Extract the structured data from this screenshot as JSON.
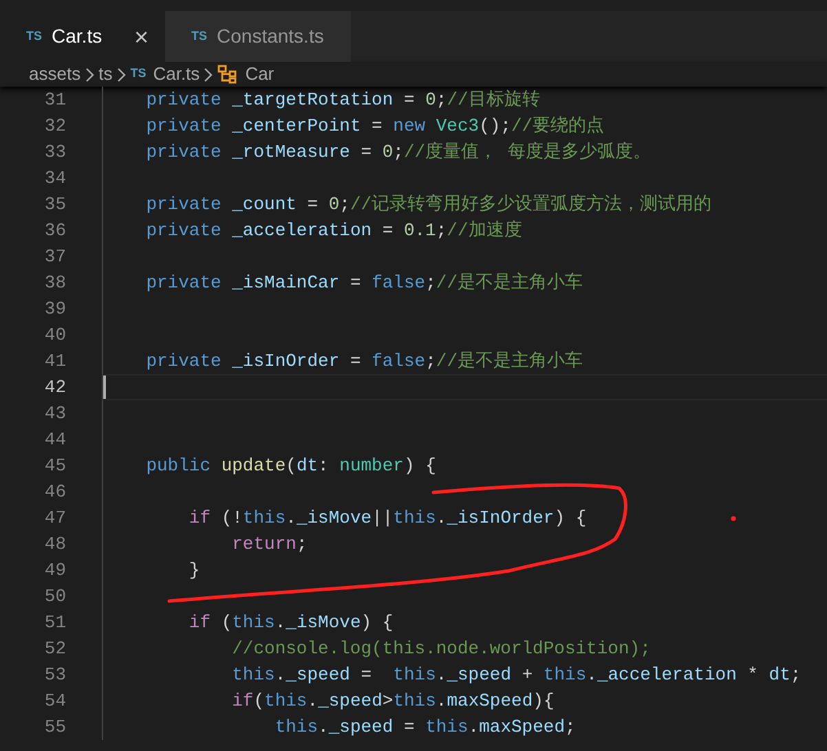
{
  "tabs": [
    {
      "label": "Car.ts",
      "badge": "TS",
      "selected": true,
      "close": "×"
    },
    {
      "label": "Constants.ts",
      "badge": "TS",
      "selected": false
    }
  ],
  "breadcrumb": [
    {
      "kind": "folder",
      "text": "assets"
    },
    {
      "kind": "folder",
      "text": "ts"
    },
    {
      "kind": "file",
      "badge": "TS",
      "text": "Car.ts"
    },
    {
      "kind": "class",
      "text": "Car"
    }
  ],
  "lines": [
    {
      "number": "31",
      "current": false,
      "tokens": [
        {
          "kind": "keyword",
          "text": "    private"
        },
        {
          "kind": "ident",
          "text": " _targetRotation"
        },
        {
          "kind": "plain",
          "text": " = "
        },
        {
          "kind": "number",
          "text": "0"
        },
        {
          "kind": "plain",
          "text": ";"
        },
        {
          "kind": "comment",
          "text": "//目标旋转"
        }
      ]
    },
    {
      "number": "32",
      "current": false,
      "tokens": [
        {
          "kind": "keyword",
          "text": "    private"
        },
        {
          "kind": "ident",
          "text": " _centerPoint"
        },
        {
          "kind": "plain",
          "text": " = "
        },
        {
          "kind": "keyword",
          "text": "new"
        },
        {
          "kind": "type",
          "text": " Vec3"
        },
        {
          "kind": "plain",
          "text": "();"
        },
        {
          "kind": "comment",
          "text": "//要绕的点"
        }
      ]
    },
    {
      "number": "33",
      "current": false,
      "tokens": [
        {
          "kind": "keyword",
          "text": "    private"
        },
        {
          "kind": "ident",
          "text": " _rotMeasure"
        },
        {
          "kind": "plain",
          "text": " = "
        },
        {
          "kind": "number",
          "text": "0"
        },
        {
          "kind": "plain",
          "text": ";"
        },
        {
          "kind": "comment",
          "text": "//度量值， 每度是多少弧度。"
        }
      ]
    },
    {
      "number": "34",
      "current": false
    },
    {
      "number": "35",
      "current": false,
      "tokens": [
        {
          "kind": "keyword",
          "text": "    private"
        },
        {
          "kind": "ident",
          "text": " _count"
        },
        {
          "kind": "plain",
          "text": " = "
        },
        {
          "kind": "number",
          "text": "0"
        },
        {
          "kind": "plain",
          "text": ";"
        },
        {
          "kind": "comment",
          "text": "//记录转弯用好多少设置弧度方法，测试用的"
        }
      ]
    },
    {
      "number": "36",
      "current": false,
      "tokens": [
        {
          "kind": "keyword",
          "text": "    private"
        },
        {
          "kind": "ident",
          "text": " _acceleration"
        },
        {
          "kind": "plain",
          "text": " = "
        },
        {
          "kind": "number",
          "text": "0.1"
        },
        {
          "kind": "plain",
          "text": ";"
        },
        {
          "kind": "comment",
          "text": "//加速度"
        }
      ]
    },
    {
      "number": "37",
      "current": false
    },
    {
      "number": "38",
      "current": false,
      "tokens": [
        {
          "kind": "keyword",
          "text": "    private"
        },
        {
          "kind": "ident",
          "text": " _isMainCar"
        },
        {
          "kind": "plain",
          "text": " = "
        },
        {
          "kind": "keyword",
          "text": "false"
        },
        {
          "kind": "plain",
          "text": ";"
        },
        {
          "kind": "comment",
          "text": "//是不是主角小车"
        }
      ]
    },
    {
      "number": "39",
      "current": false
    },
    {
      "number": "40",
      "current": false
    },
    {
      "number": "41",
      "current": false,
      "tokens": [
        {
          "kind": "keyword",
          "text": "    private"
        },
        {
          "kind": "ident",
          "text": " _isInOrder"
        },
        {
          "kind": "plain",
          "text": " = "
        },
        {
          "kind": "keyword",
          "text": "false"
        },
        {
          "kind": "plain",
          "text": ";"
        },
        {
          "kind": "comment",
          "text": "//是不是主角小车"
        }
      ]
    },
    {
      "number": "42",
      "current": true
    },
    {
      "number": "43",
      "current": false
    },
    {
      "number": "44",
      "current": false
    },
    {
      "number": "45",
      "current": false,
      "tokens": [
        {
          "kind": "keyword",
          "text": "    public"
        },
        {
          "kind": "function",
          "text": " update"
        },
        {
          "kind": "plain",
          "text": "("
        },
        {
          "kind": "ident",
          "text": "dt"
        },
        {
          "kind": "plain",
          "text": ": "
        },
        {
          "kind": "type",
          "text": "number"
        },
        {
          "kind": "plain",
          "text": ") {"
        }
      ]
    },
    {
      "number": "46",
      "current": false
    },
    {
      "number": "47",
      "current": false,
      "tokens": [
        {
          "kind": "control",
          "text": "        if"
        },
        {
          "kind": "plain",
          "text": " (!"
        },
        {
          "kind": "keyword",
          "text": "this"
        },
        {
          "kind": "plain",
          "text": "."
        },
        {
          "kind": "ident",
          "text": "_isMove"
        },
        {
          "kind": "plain",
          "text": "||"
        },
        {
          "kind": "keyword",
          "text": "this"
        },
        {
          "kind": "plain",
          "text": "."
        },
        {
          "kind": "ident",
          "text": "_isInOrder"
        },
        {
          "kind": "plain",
          "text": ") {"
        }
      ]
    },
    {
      "number": "48",
      "current": false,
      "tokens": [
        {
          "kind": "control",
          "text": "            return"
        },
        {
          "kind": "plain",
          "text": ";"
        }
      ]
    },
    {
      "number": "49",
      "current": false,
      "tokens": [
        {
          "kind": "plain",
          "text": "        }"
        }
      ]
    },
    {
      "number": "50",
      "current": false
    },
    {
      "number": "51",
      "current": false,
      "tokens": [
        {
          "kind": "control",
          "text": "        if"
        },
        {
          "kind": "plain",
          "text": " ("
        },
        {
          "kind": "keyword",
          "text": "this"
        },
        {
          "kind": "plain",
          "text": "."
        },
        {
          "kind": "ident",
          "text": "_isMove"
        },
        {
          "kind": "plain",
          "text": ") {"
        }
      ]
    },
    {
      "number": "52",
      "current": false,
      "tokens": [
        {
          "kind": "comment",
          "text": "            //console.log(this.node.worldPosition);"
        }
      ]
    },
    {
      "number": "53",
      "current": false,
      "tokens": [
        {
          "kind": "keyword",
          "text": "            this"
        },
        {
          "kind": "plain",
          "text": "."
        },
        {
          "kind": "ident",
          "text": "_speed"
        },
        {
          "kind": "plain",
          "text": " =  "
        },
        {
          "kind": "keyword",
          "text": "this"
        },
        {
          "kind": "plain",
          "text": "."
        },
        {
          "kind": "ident",
          "text": "_speed"
        },
        {
          "kind": "plain",
          "text": " + "
        },
        {
          "kind": "keyword",
          "text": "this"
        },
        {
          "kind": "plain",
          "text": "."
        },
        {
          "kind": "ident",
          "text": "_acceleration"
        },
        {
          "kind": "plain",
          "text": " * "
        },
        {
          "kind": "ident",
          "text": "dt"
        },
        {
          "kind": "plain",
          "text": ";"
        }
      ]
    },
    {
      "number": "54",
      "current": false,
      "tokens": [
        {
          "kind": "control",
          "text": "            if"
        },
        {
          "kind": "plain",
          "text": "("
        },
        {
          "kind": "keyword",
          "text": "this"
        },
        {
          "kind": "plain",
          "text": "."
        },
        {
          "kind": "ident",
          "text": "_speed"
        },
        {
          "kind": "plain",
          "text": ">"
        },
        {
          "kind": "keyword",
          "text": "this"
        },
        {
          "kind": "plain",
          "text": "."
        },
        {
          "kind": "ident",
          "text": "maxSpeed"
        },
        {
          "kind": "plain",
          "text": "){"
        }
      ]
    },
    {
      "number": "55",
      "current": false,
      "tokens": [
        {
          "kind": "keyword",
          "text": "                this"
        },
        {
          "kind": "plain",
          "text": "."
        },
        {
          "kind": "ident",
          "text": "_speed"
        },
        {
          "kind": "plain",
          "text": " = "
        },
        {
          "kind": "keyword",
          "text": "this"
        },
        {
          "kind": "plain",
          "text": "."
        },
        {
          "kind": "ident",
          "text": "maxSpeed"
        },
        {
          "kind": "plain",
          "text": ";"
        }
      ]
    }
  ]
}
